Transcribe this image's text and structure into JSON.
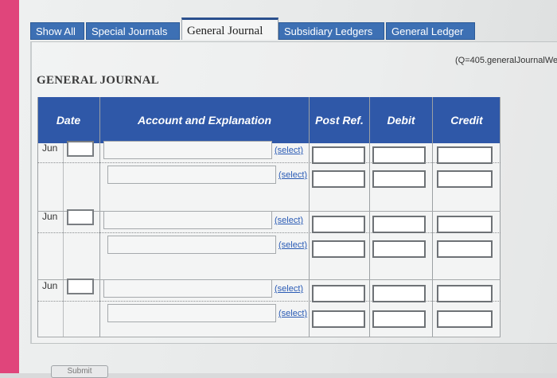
{
  "tabs": [
    "Show All",
    "Special Journals",
    "General Journal",
    "Subsidiary Ledgers",
    "General Ledger"
  ],
  "active_tab": "General Journal",
  "question_ref": "(Q=405.generalJournalWe",
  "heading": "GENERAL JOURNAL",
  "table": {
    "columns": {
      "date": "Date",
      "account": "Account and Explanation",
      "post_ref": "Post Ref.",
      "debit": "Debit",
      "credit": "Credit"
    },
    "entries": [
      {
        "month": "Jun",
        "lines": [
          {
            "select_label": "(select)"
          },
          {
            "select_label": "(select)"
          }
        ]
      },
      {
        "month": "Jun",
        "lines": [
          {
            "select_label": "(select)"
          },
          {
            "select_label": "(select)"
          }
        ]
      },
      {
        "month": "Jun",
        "lines": [
          {
            "select_label": "(select)"
          },
          {
            "select_label": "(select)"
          }
        ]
      }
    ]
  },
  "footer_button": "Submit"
}
